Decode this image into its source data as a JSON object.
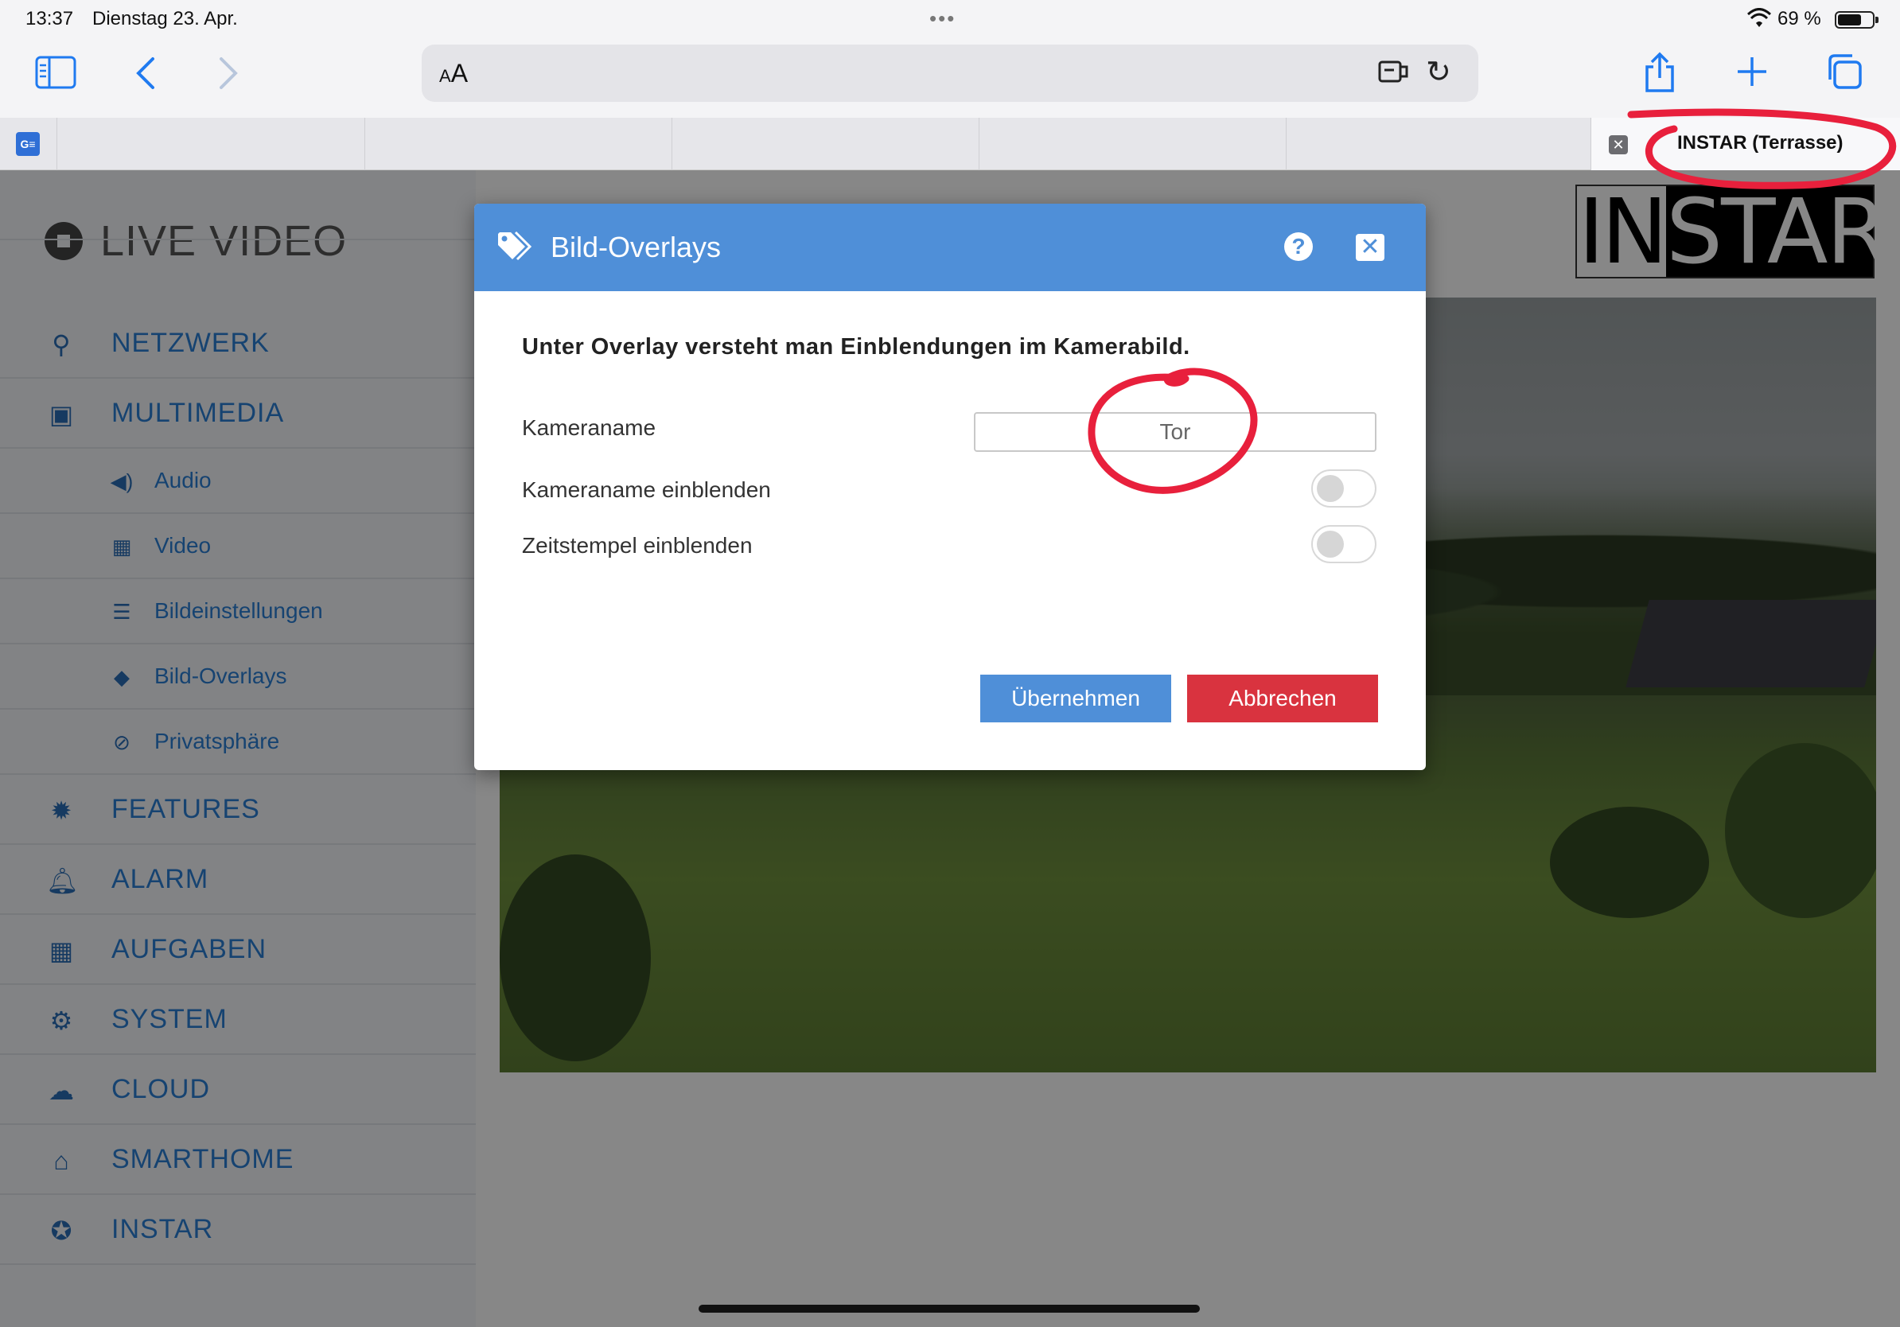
{
  "status_bar": {
    "time": "13:37",
    "date": "Dienstag 23. Apr.",
    "battery": "69 %",
    "battery_level": 0.69
  },
  "browser": {
    "address_aa": "AA",
    "tabs": [
      {
        "title": "",
        "active": false
      },
      {
        "title": "",
        "active": false
      },
      {
        "title": "",
        "active": false
      },
      {
        "title": "",
        "active": false
      },
      {
        "title": "",
        "active": false
      },
      {
        "title": "INSTAR (Terrasse)",
        "active": true
      }
    ],
    "accent_color": "#1f7af0"
  },
  "sidebar": {
    "live_video": "LIVE VIDEO",
    "items": [
      {
        "label": "NETZWERK",
        "icon": "network-icon"
      },
      {
        "label": "MULTIMEDIA",
        "icon": "image-icon"
      },
      {
        "label": "Audio",
        "icon": "speaker-icon",
        "sub": true
      },
      {
        "label": "Video",
        "icon": "film-icon",
        "sub": true
      },
      {
        "label": "Bildeinstellungen",
        "icon": "sliders-icon",
        "sub": true
      },
      {
        "label": "Bild-Overlays",
        "icon": "tags-icon",
        "sub": true
      },
      {
        "label": "Privatsphäre",
        "icon": "eye-slash-icon",
        "sub": true
      },
      {
        "label": "FEATURES",
        "icon": "gear-badge-icon"
      },
      {
        "label": "ALARM",
        "icon": "bell-icon"
      },
      {
        "label": "AUFGABEN",
        "icon": "film-icon"
      },
      {
        "label": "SYSTEM",
        "icon": "gear-icon"
      },
      {
        "label": "CLOUD",
        "icon": "cloud-icon"
      },
      {
        "label": "SMARTHOME",
        "icon": "home-icon"
      },
      {
        "label": "INSTAR",
        "icon": "star-icon"
      }
    ]
  },
  "logo": {
    "part1": "IN",
    "part2": "STAR"
  },
  "modal": {
    "title": "Bild-Overlays",
    "intro": "Unter Overlay versteht man Einblendungen im Kamerabild.",
    "camera_name_label": "Kameraname",
    "camera_name_value": "Tor",
    "show_name_label": "Kameraname einblenden",
    "show_name_on": false,
    "show_timestamp_label": "Zeitstempel einblenden",
    "show_timestamp_on": false,
    "apply_label": "Übernehmen",
    "cancel_label": "Abbrechen",
    "header_color": "#4f8fd8",
    "cancel_color": "#d9333f"
  },
  "annotation_color": "#e8203c"
}
